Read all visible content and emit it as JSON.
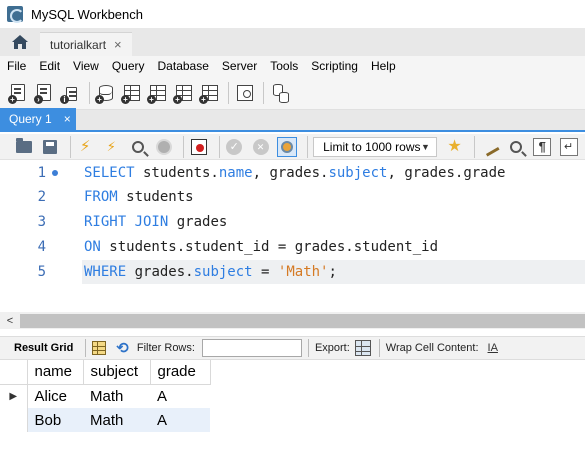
{
  "window": {
    "title": "MySQL Workbench"
  },
  "connection_tabs": [
    {
      "label": "tutorialkart",
      "close": "×"
    }
  ],
  "menu": [
    "File",
    "Edit",
    "View",
    "Query",
    "Database",
    "Server",
    "Tools",
    "Scripting",
    "Help"
  ],
  "main_toolbar_icons": [
    "new-sql-tab-icon",
    "open-sql-script-icon",
    "open-inspector-icon",
    "create-schema-icon",
    "create-table-icon",
    "create-view-icon",
    "create-procedure-icon",
    "create-function-icon",
    "search-table-data-icon",
    "reconnect-icon"
  ],
  "query_tab": {
    "label": "Query 1",
    "close": "×"
  },
  "sql_toolbar": {
    "limit_select": {
      "value": "Limit to 1000 rows"
    }
  },
  "editor": {
    "lines": [
      {
        "number": "1"
      },
      {
        "number": "2"
      },
      {
        "number": "3"
      },
      {
        "number": "4"
      },
      {
        "number": "5"
      }
    ],
    "tokens": {
      "l1_kw": "SELECT",
      "l1_a": " students.",
      "l1_kw2": "name",
      "l1_b": ", grades.",
      "l1_kw3": "subject",
      "l1_c": ", grades.grade",
      "l2_kw": "FROM",
      "l2_a": " students",
      "l3_kw": "RIGHT JOIN",
      "l3_a": " grades",
      "l4_kw": "ON",
      "l4_a": " students.student_id = grades.student_id",
      "l5_kw": "WHERE",
      "l5_a": " grades.",
      "l5_kw2": "subject",
      "l5_b": " = ",
      "l5_str": "'Math'",
      "l5_c": ";"
    }
  },
  "results_toolbar": {
    "result_grid_label": "Result Grid",
    "filter_rows_label": "Filter Rows:",
    "filter_value": "",
    "export_label": "Export:",
    "wrap_label": "Wrap Cell Content:",
    "wrap_icon_text": "IA"
  },
  "result_grid": {
    "columns": [
      "name",
      "subject",
      "grade"
    ],
    "rows": [
      [
        "Alice",
        "Math",
        "A"
      ],
      [
        "Bob",
        "Math",
        "A"
      ]
    ],
    "row_indicator": "▶"
  },
  "colors": {
    "accent": "#3d8ee0",
    "keyword": "#2e7de1",
    "string": "#d57a24"
  }
}
